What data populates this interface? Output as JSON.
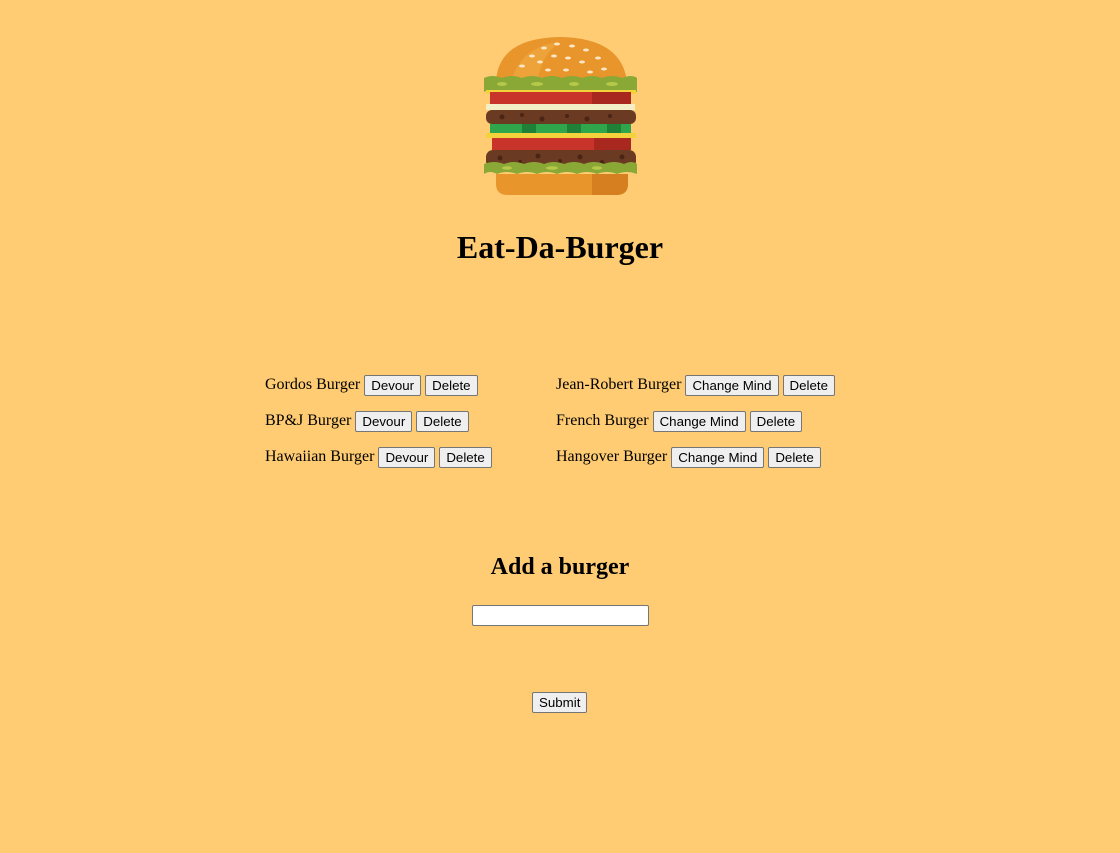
{
  "page": {
    "title": "Eat-Da-Burger",
    "logo_icon": "burger-icon",
    "background_color": "#ffcc73"
  },
  "uneaten_burgers": [
    {
      "name": "Gordos Burger",
      "action_label": "Devour",
      "delete_label": "Delete"
    },
    {
      "name": "BP&J Burger",
      "action_label": "Devour",
      "delete_label": "Delete"
    },
    {
      "name": "Hawaiian Burger",
      "action_label": "Devour",
      "delete_label": "Delete"
    }
  ],
  "devoured_burgers": [
    {
      "name": "Jean-Robert Burger",
      "action_label": "Change Mind",
      "delete_label": "Delete"
    },
    {
      "name": "French Burger",
      "action_label": "Change Mind",
      "delete_label": "Delete"
    },
    {
      "name": "Hangover Burger",
      "action_label": "Change Mind",
      "delete_label": "Delete"
    }
  ],
  "add_form": {
    "heading": "Add a burger",
    "input_value": "",
    "input_placeholder": "",
    "submit_label": "Submit"
  }
}
